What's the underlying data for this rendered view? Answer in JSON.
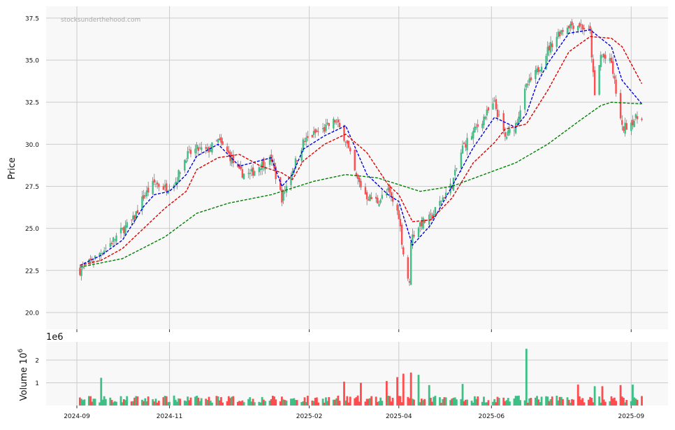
{
  "watermark": "stocksunderthehood.com",
  "colors": {
    "up": "#3dbf85",
    "down": "#ff4d4f",
    "ma_fast": "#0000dd",
    "ma_mid": "#dd0000",
    "ma_slow": "#008000",
    "panel_bg": "#f8f8f8",
    "grid": "#cccccc"
  },
  "chart_data": [
    {
      "type": "candlestick",
      "ylabel": "Price",
      "ylim": [
        19.0,
        38.2
      ],
      "yticks": [
        "20.0",
        "22.5",
        "25.0",
        "27.5",
        "30.0",
        "32.5",
        "35.0",
        "37.5"
      ],
      "grid": true,
      "x_dates_start": "2024-09-03",
      "x_dates_end": "2025-09-08",
      "close_points": [
        [
          "2024-09-03",
          22.5
        ],
        [
          "2024-09-10",
          23.0
        ],
        [
          "2024-09-17",
          23.6
        ],
        [
          "2024-09-24",
          24.2
        ],
        [
          "2024-10-01",
          24.9
        ],
        [
          "2024-10-08",
          25.5
        ],
        [
          "2024-10-15",
          26.9
        ],
        [
          "2024-10-22",
          27.7
        ],
        [
          "2024-10-29",
          27.4
        ],
        [
          "2024-11-05",
          27.8
        ],
        [
          "2024-11-12",
          29.3
        ],
        [
          "2024-11-19",
          29.7
        ],
        [
          "2024-11-26",
          29.6
        ],
        [
          "2024-12-03",
          30.2
        ],
        [
          "2024-12-10",
          29.4
        ],
        [
          "2024-12-17",
          28.3
        ],
        [
          "2024-12-24",
          28.2
        ],
        [
          "2024-12-31",
          28.8
        ],
        [
          "2025-01-07",
          29.1
        ],
        [
          "2025-01-14",
          26.8
        ],
        [
          "2025-01-21",
          28.5
        ],
        [
          "2025-01-28",
          30.1
        ],
        [
          "2025-02-04",
          30.6
        ],
        [
          "2025-02-11",
          30.9
        ],
        [
          "2025-02-18",
          31.4
        ],
        [
          "2025-02-25",
          30.3
        ],
        [
          "2025-03-04",
          28.0
        ],
        [
          "2025-03-11",
          26.9
        ],
        [
          "2025-03-18",
          26.6
        ],
        [
          "2025-03-25",
          27.2
        ],
        [
          "2025-04-01",
          25.8
        ],
        [
          "2025-04-04",
          23.5
        ],
        [
          "2025-04-08",
          21.6
        ],
        [
          "2025-04-09",
          24.4
        ],
        [
          "2025-04-15",
          25.3
        ],
        [
          "2025-04-22",
          25.6
        ],
        [
          "2025-04-29",
          26.7
        ],
        [
          "2025-05-06",
          27.6
        ],
        [
          "2025-05-13",
          29.8
        ],
        [
          "2025-05-20",
          30.7
        ],
        [
          "2025-05-27",
          31.6
        ],
        [
          "2025-06-03",
          32.4
        ],
        [
          "2025-06-10",
          30.4
        ],
        [
          "2025-06-17",
          31.2
        ],
        [
          "2025-06-24",
          33.4
        ],
        [
          "2025-07-01",
          34.3
        ],
        [
          "2025-07-08",
          35.6
        ],
        [
          "2025-07-15",
          36.6
        ],
        [
          "2025-07-22",
          37.1
        ],
        [
          "2025-07-29",
          37.1
        ],
        [
          "2025-08-05",
          36.6
        ],
        [
          "2025-08-08",
          32.8
        ],
        [
          "2025-08-12",
          35.3
        ],
        [
          "2025-08-19",
          34.8
        ],
        [
          "2025-08-26",
          30.9
        ],
        [
          "2025-09-02",
          31.4
        ],
        [
          "2025-09-08",
          31.7
        ]
      ],
      "series": [
        {
          "name": "",
          "color_key": "ma_fast",
          "points": [
            [
              "2024-09-03",
              22.8
            ],
            [
              "2024-09-17",
              23.4
            ],
            [
              "2024-10-01",
              24.3
            ],
            [
              "2024-10-15",
              26.3
            ],
            [
              "2024-10-22",
              27.0
            ],
            [
              "2024-11-01",
              27.2
            ],
            [
              "2024-11-12",
              28.2
            ],
            [
              "2024-11-19",
              29.3
            ],
            [
              "2024-12-03",
              30.0
            ],
            [
              "2024-12-17",
              28.7
            ],
            [
              "2025-01-07",
              29.2
            ],
            [
              "2025-01-14",
              27.5
            ],
            [
              "2025-01-21",
              28.2
            ],
            [
              "2025-01-28",
              29.7
            ],
            [
              "2025-02-11",
              30.5
            ],
            [
              "2025-02-25",
              31.1
            ],
            [
              "2025-03-11",
              28.2
            ],
            [
              "2025-03-25",
              27.0
            ],
            [
              "2025-04-01",
              26.6
            ],
            [
              "2025-04-10",
              24.0
            ],
            [
              "2025-04-22",
              25.2
            ],
            [
              "2025-05-06",
              27.5
            ],
            [
              "2025-05-20",
              29.8
            ],
            [
              "2025-06-03",
              31.6
            ],
            [
              "2025-06-17",
              31.0
            ],
            [
              "2025-06-24",
              31.8
            ],
            [
              "2025-07-01",
              33.6
            ],
            [
              "2025-07-08",
              34.8
            ],
            [
              "2025-07-22",
              36.6
            ],
            [
              "2025-08-05",
              36.8
            ],
            [
              "2025-08-19",
              35.8
            ],
            [
              "2025-08-26",
              33.8
            ],
            [
              "2025-09-08",
              32.4
            ]
          ]
        },
        {
          "name": "",
          "color_key": "ma_mid",
          "points": [
            [
              "2024-09-03",
              22.8
            ],
            [
              "2024-09-17",
              23.1
            ],
            [
              "2024-10-01",
              23.8
            ],
            [
              "2024-10-15",
              25.0
            ],
            [
              "2024-10-29",
              26.2
            ],
            [
              "2024-11-12",
              27.2
            ],
            [
              "2024-11-19",
              28.5
            ],
            [
              "2024-12-03",
              29.2
            ],
            [
              "2024-12-17",
              29.4
            ],
            [
              "2024-12-31",
              28.7
            ],
            [
              "2025-01-14",
              28.3
            ],
            [
              "2025-01-21",
              27.9
            ],
            [
              "2025-01-28",
              29.0
            ],
            [
              "2025-02-11",
              30.0
            ],
            [
              "2025-02-25",
              30.6
            ],
            [
              "2025-03-11",
              29.5
            ],
            [
              "2025-03-25",
              27.6
            ],
            [
              "2025-04-01",
              27.0
            ],
            [
              "2025-04-10",
              25.4
            ],
            [
              "2025-04-22",
              25.5
            ],
            [
              "2025-05-06",
              26.8
            ],
            [
              "2025-05-20",
              28.9
            ],
            [
              "2025-06-03",
              30.1
            ],
            [
              "2025-06-10",
              30.9
            ],
            [
              "2025-06-24",
              31.2
            ],
            [
              "2025-07-08",
              33.2
            ],
            [
              "2025-07-22",
              35.5
            ],
            [
              "2025-08-05",
              36.4
            ],
            [
              "2025-08-19",
              36.3
            ],
            [
              "2025-08-26",
              35.8
            ],
            [
              "2025-09-08",
              33.6
            ]
          ]
        },
        {
          "name": "",
          "color_key": "ma_slow",
          "points": [
            [
              "2024-09-03",
              22.7
            ],
            [
              "2024-10-01",
              23.2
            ],
            [
              "2024-10-29",
              24.5
            ],
            [
              "2024-11-19",
              25.9
            ],
            [
              "2024-12-10",
              26.5
            ],
            [
              "2025-01-07",
              27.0
            ],
            [
              "2025-02-04",
              27.8
            ],
            [
              "2025-02-25",
              28.2
            ],
            [
              "2025-03-18",
              28.0
            ],
            [
              "2025-04-01",
              27.6
            ],
            [
              "2025-04-15",
              27.2
            ],
            [
              "2025-05-06",
              27.5
            ],
            [
              "2025-05-27",
              28.2
            ],
            [
              "2025-06-17",
              28.9
            ],
            [
              "2025-07-08",
              30.0
            ],
            [
              "2025-07-29",
              31.4
            ],
            [
              "2025-08-12",
              32.3
            ],
            [
              "2025-08-19",
              32.5
            ],
            [
              "2025-09-08",
              32.4
            ]
          ]
        }
      ]
    },
    {
      "type": "bar",
      "ylabel": "Volume  10",
      "ylabel_exp": "6",
      "offset_label": "1e6",
      "yticks": [
        "1",
        "2"
      ],
      "ylim": [
        0,
        2.8
      ],
      "grid": true,
      "spikes": [
        [
          "2024-09-17",
          1.22,
          "up"
        ],
        [
          "2024-12-03",
          0.4,
          "up"
        ],
        [
          "2025-02-24",
          1.05,
          "down"
        ],
        [
          "2025-03-07",
          1.0,
          "down"
        ],
        [
          "2025-03-24",
          1.08,
          "down"
        ],
        [
          "2025-03-31",
          1.25,
          "down"
        ],
        [
          "2025-04-04",
          1.4,
          "down"
        ],
        [
          "2025-04-09",
          1.45,
          "down"
        ],
        [
          "2025-04-14",
          1.35,
          "up"
        ],
        [
          "2025-04-21",
          0.9,
          "up"
        ],
        [
          "2025-05-13",
          0.95,
          "up"
        ],
        [
          "2025-06-24",
          2.5,
          "up"
        ],
        [
          "2025-07-28",
          0.92,
          "down"
        ],
        [
          "2025-08-08",
          0.85,
          "up"
        ],
        [
          "2025-08-13",
          0.85,
          "down"
        ],
        [
          "2025-08-25",
          0.9,
          "down"
        ],
        [
          "2025-09-02",
          0.92,
          "up"
        ]
      ]
    }
  ],
  "x_axis": {
    "ticks": [
      {
        "date": "2024-09-01",
        "label": "2024-09"
      },
      {
        "date": "2024-11-01",
        "label": "2024-11"
      },
      {
        "date": "2025-02-01",
        "label": "2025-02"
      },
      {
        "date": "2025-04-01",
        "label": "2025-04"
      },
      {
        "date": "2025-06-01",
        "label": "2025-06"
      },
      {
        "date": "2025-09-01",
        "label": "2025-09"
      }
    ]
  }
}
